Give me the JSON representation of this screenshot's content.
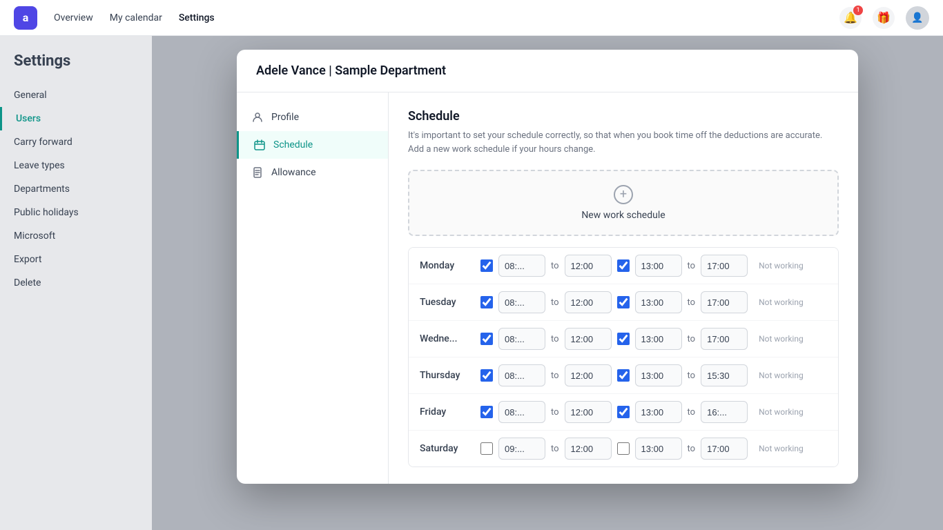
{
  "app": {
    "logo": "a",
    "nav": {
      "links": [
        "Overview",
        "My calendar",
        "Settings"
      ]
    }
  },
  "modal": {
    "header": "Adele Vance | Sample Department",
    "sidebar": {
      "items": [
        {
          "id": "profile",
          "label": "Profile",
          "icon": "person"
        },
        {
          "id": "schedule",
          "label": "Schedule",
          "icon": "calendar",
          "active": true
        },
        {
          "id": "allowance",
          "label": "Allowance",
          "icon": "document"
        }
      ]
    },
    "schedule": {
      "title": "Schedule",
      "description": "It's important to set your schedule correctly, so that when you book time off the deductions are accurate. Add a new work schedule if your hours change.",
      "new_schedule_label": "New work schedule",
      "days": [
        {
          "name": "Monday",
          "checked": true,
          "start": "08:...",
          "break_end": "12:00",
          "break_checked": true,
          "afternoon_start": "13:00",
          "end": "17:00",
          "not_working": "Not working"
        },
        {
          "name": "Tuesday",
          "checked": true,
          "start": "08:...",
          "break_end": "12:00",
          "break_checked": true,
          "afternoon_start": "13:00",
          "end": "17:00",
          "not_working": "Not working"
        },
        {
          "name": "Wedne...",
          "checked": true,
          "start": "08:...",
          "break_end": "12:00",
          "break_checked": true,
          "afternoon_start": "13:00",
          "end": "17:00",
          "not_working": "Not working"
        },
        {
          "name": "Thursday",
          "checked": true,
          "start": "08:...",
          "break_end": "12:00",
          "break_checked": true,
          "afternoon_start": "13:00",
          "end": "15:30",
          "not_working": "Not working"
        },
        {
          "name": "Friday",
          "checked": true,
          "start": "08:...",
          "break_end": "12:00",
          "break_checked": true,
          "afternoon_start": "13:00",
          "end": "16:...",
          "not_working": "Not working"
        },
        {
          "name": "Saturday",
          "checked": false,
          "start": "09:...",
          "break_end": "12:00",
          "break_checked": false,
          "afternoon_start": "13:00",
          "end": "17:00",
          "not_working": "Not working"
        }
      ]
    }
  },
  "settings": {
    "title": "Settings",
    "sidebar_items": [
      {
        "label": "General"
      },
      {
        "label": "Users",
        "active": true
      },
      {
        "label": "Carry forward"
      },
      {
        "label": "Leave types"
      },
      {
        "label": "Departments"
      },
      {
        "label": "Public holidays"
      },
      {
        "label": "Microsoft"
      },
      {
        "label": "Export"
      },
      {
        "label": "Delete"
      }
    ]
  }
}
